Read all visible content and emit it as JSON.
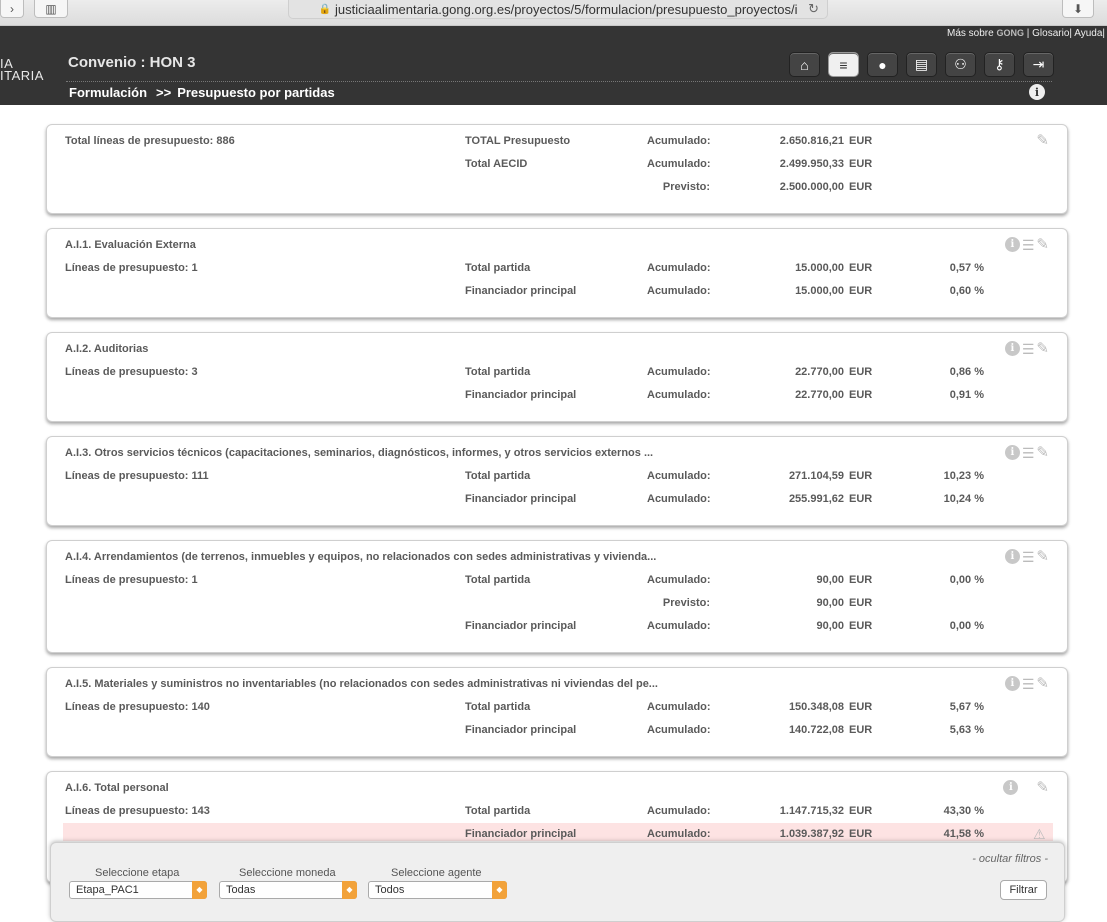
{
  "browser": {
    "url": "justiciaalimentaria.gong.org.es/proyectos/5/formulacion/presupuesto_proyectos/i"
  },
  "header": {
    "logo_fragment_1": "IA",
    "logo_fragment_2": "ITARIA",
    "links_prefix": "Más sobre",
    "links_brand": "GONG",
    "links_rest": "| Glosario| Ayuda|",
    "project_title": "Convenio : HON 3",
    "crumb_section": "Formulación",
    "crumb_sep": ">>",
    "crumb_page": "Presupuesto por partidas",
    "nav_icons": [
      "home-icon",
      "database-icon",
      "user-icon",
      "wallet-icon",
      "users-icon",
      "key-icon",
      "exit-icon"
    ]
  },
  "summary": {
    "total_lines": "Total líneas de presupuesto: 886",
    "rows": [
      {
        "label": "TOTAL Presupuesto",
        "kind": "Acumulado:",
        "amount": "2.650.816,21",
        "cur": "EUR"
      },
      {
        "label": "Total AECID",
        "kind": "Acumulado:",
        "amount": "2.499.950,33",
        "cur": "EUR"
      },
      {
        "label": "",
        "kind": "Previsto:",
        "amount": "2.500.000,00",
        "cur": "EUR"
      }
    ]
  },
  "items": [
    {
      "title": "A.I.1. Evaluación Externa",
      "lines": "Líneas de presupuesto: 1",
      "rows": [
        {
          "label": "Total partida",
          "kind": "Acumulado:",
          "amount": "15.000,00",
          "cur": "EUR",
          "pct": "0,57 %"
        },
        {
          "label": "Financiador principal",
          "kind": "Acumulado:",
          "amount": "15.000,00",
          "cur": "EUR",
          "pct": "0,60 %"
        }
      ]
    },
    {
      "title": "A.I.2. Auditorias",
      "lines": "Líneas de presupuesto: 3",
      "rows": [
        {
          "label": "Total partida",
          "kind": "Acumulado:",
          "amount": "22.770,00",
          "cur": "EUR",
          "pct": "0,86 %"
        },
        {
          "label": "Financiador principal",
          "kind": "Acumulado:",
          "amount": "22.770,00",
          "cur": "EUR",
          "pct": "0,91 %"
        }
      ]
    },
    {
      "title": "A.I.3. Otros servicios técnicos (capacitaciones, seminarios, diagnósticos, informes, y otros servicios externos ...",
      "lines": "Líneas de presupuesto: 111",
      "rows": [
        {
          "label": "Total partida",
          "kind": "Acumulado:",
          "amount": "271.104,59",
          "cur": "EUR",
          "pct": "10,23 %"
        },
        {
          "label": "Financiador principal",
          "kind": "Acumulado:",
          "amount": "255.991,62",
          "cur": "EUR",
          "pct": "10,24 %"
        }
      ]
    },
    {
      "title": "A.I.4. Arrendamientos (de terrenos, inmuebles y equipos, no relacionados con sedes administrativas y vivienda...",
      "lines": "Líneas de presupuesto: 1",
      "rows": [
        {
          "label": "Total partida",
          "kind": "Acumulado:",
          "amount": "90,00",
          "cur": "EUR",
          "pct": "0,00 %"
        },
        {
          "label": "",
          "kind": "Previsto:",
          "amount": "90,00",
          "cur": "EUR",
          "pct": ""
        },
        {
          "label": "Financiador principal",
          "kind": "Acumulado:",
          "amount": "90,00",
          "cur": "EUR",
          "pct": "0,00 %"
        }
      ]
    },
    {
      "title": "A.I.5. Materiales y suministros no inventariables (no relacionados con sedes administrativas ni viviendas del pe...",
      "lines": "Líneas de presupuesto: 140",
      "rows": [
        {
          "label": "Total partida",
          "kind": "Acumulado:",
          "amount": "150.348,08",
          "cur": "EUR",
          "pct": "5,67 %"
        },
        {
          "label": "Financiador principal",
          "kind": "Acumulado:",
          "amount": "140.722,08",
          "cur": "EUR",
          "pct": "5,63 %"
        }
      ]
    },
    {
      "title": "A.I.6. Total personal",
      "lines": "Líneas de presupuesto: 143",
      "rows": [
        {
          "label": "Total partida",
          "kind": "Acumulado:",
          "amount": "1.147.715,32",
          "cur": "EUR",
          "pct": "43,30 %"
        },
        {
          "label": "Financiador principal",
          "kind": "Acumulado:",
          "amount": "1.039.387,92",
          "cur": "EUR",
          "pct": "41,58 %"
        }
      ]
    }
  ],
  "filters": {
    "hide_label": "- ocultar filtros -",
    "etapa_label": "Seleccione etapa",
    "etapa_value": "Etapa_PAC1",
    "moneda_label": "Seleccione moneda",
    "moneda_value": "Todas",
    "agente_label": "Seleccione agente",
    "agente_value": "Todos",
    "submit": "Filtrar"
  }
}
